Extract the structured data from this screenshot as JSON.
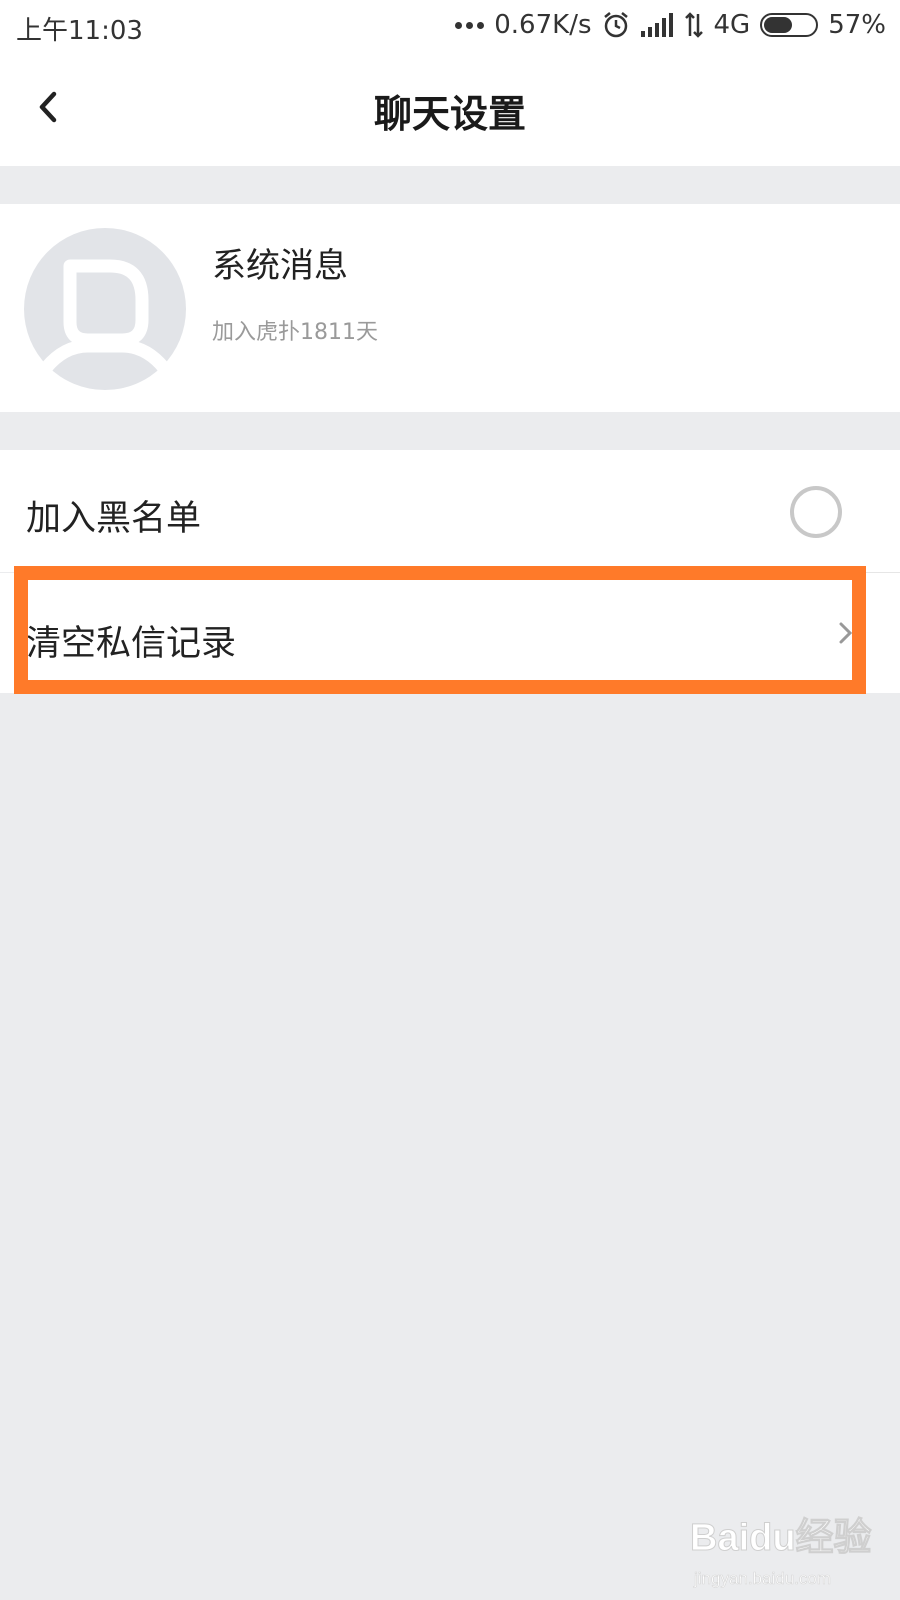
{
  "status_bar": {
    "time": "上午11:03",
    "network_speed": "0.67K/s",
    "network_type": "4G",
    "battery_percent": "57%",
    "battery_level": 0.57,
    "icons": [
      "more-dots-icon",
      "alarm-icon",
      "signal-icon",
      "data-arrows-icon",
      "battery-icon"
    ]
  },
  "header": {
    "title": "聊天设置",
    "back_icon": "chevron-left-icon"
  },
  "profile": {
    "name": "系统消息",
    "subtitle": "加入虎扑1811天",
    "avatar_icon": "default-avatar-icon"
  },
  "settings": {
    "blacklist_label": "加入黑名单",
    "blacklist_enabled": false,
    "clear_history_label": "清空私信记录",
    "clear_history_icon": "chevron-right-icon"
  },
  "annotation": {
    "highlight_color": "#FF7A29"
  },
  "watermark": {
    "brand": "Baidu经验",
    "url": "jingyan.baidu.com"
  },
  "colors": {
    "background": "#EBECEE",
    "surface": "#FFFFFF",
    "text_primary": "#222222",
    "text_secondary": "#9A9A9A",
    "highlight": "#FF7A29"
  }
}
